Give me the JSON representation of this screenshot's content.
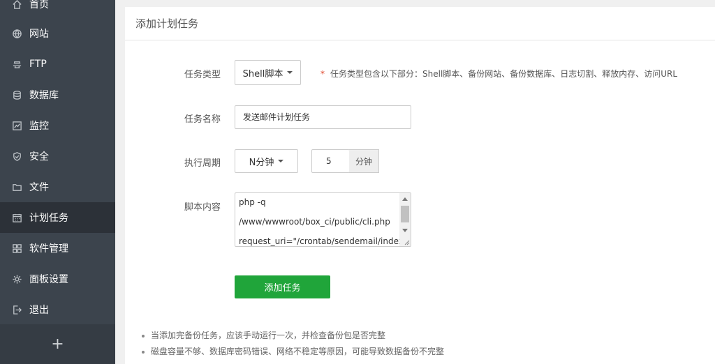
{
  "sidebar": {
    "items": [
      {
        "label": "首页",
        "icon": "home-icon"
      },
      {
        "label": "网站",
        "icon": "globe-icon"
      },
      {
        "label": "FTP",
        "icon": "ftp-icon"
      },
      {
        "label": "数据库",
        "icon": "database-icon"
      },
      {
        "label": "监控",
        "icon": "monitor-icon"
      },
      {
        "label": "安全",
        "icon": "shield-icon"
      },
      {
        "label": "文件",
        "icon": "folder-icon"
      },
      {
        "label": "计划任务",
        "icon": "calendar-icon"
      },
      {
        "label": "软件管理",
        "icon": "apps-icon"
      },
      {
        "label": "面板设置",
        "icon": "gear-icon"
      },
      {
        "label": "退出",
        "icon": "logout-icon"
      }
    ],
    "active_index": 7,
    "footer_label": "+"
  },
  "panel": {
    "title": "添加计划任务"
  },
  "form": {
    "task_type": {
      "label": "任务类型",
      "value": "Shell脚本",
      "hint_star": "*",
      "hint": "任务类型包含以下部分：Shell脚本、备份网站、备份数据库、日志切割、释放内存、访问URL"
    },
    "task_name": {
      "label": "任务名称",
      "value": "发送邮件计划任务"
    },
    "period": {
      "label": "执行周期",
      "value": "N分钟",
      "minutes": "5",
      "unit": "分钟"
    },
    "script": {
      "label": "脚本内容",
      "lines": [
        "php -q",
        "/www/wwwroot/box_ci/public/cli.php",
        "request_uri=\"/crontab/sendemail/index\""
      ]
    },
    "submit_label": "添加任务"
  },
  "notes": [
    "当添加完备份任务，应该手动运行一次，并检查备份包是否完整",
    "磁盘容量不够、数据库密码错误、网络不稳定等原因，可能导致数据备份不完整"
  ],
  "colors": {
    "sidebar_bg": "#3c444d",
    "sidebar_active_bg": "#2c3138",
    "accent_green": "#20a53a",
    "hint_star": "#e0492f"
  }
}
